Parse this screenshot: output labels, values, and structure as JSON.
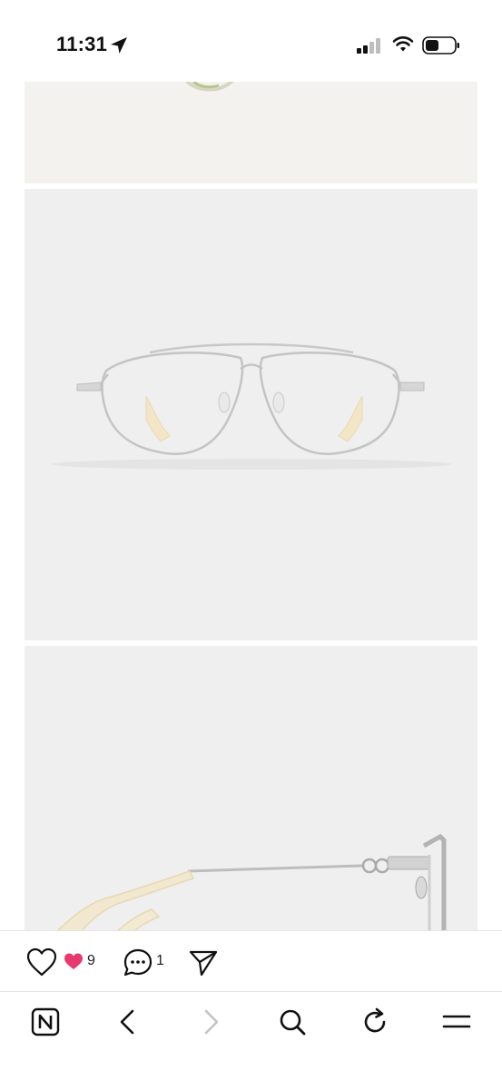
{
  "status_bar": {
    "time": "11:31",
    "icons": [
      "location-arrow-icon",
      "cellular-signal-icon",
      "wifi-icon",
      "battery-icon"
    ]
  },
  "feed": {
    "images": [
      {
        "subject": "glasses-temple-tip-partial"
      },
      {
        "subject": "silver-aviator-eyeglasses-front"
      },
      {
        "subject": "eyeglasses-temple-side-view"
      }
    ]
  },
  "actions": {
    "like_icon": "heart-outline-icon",
    "likes_icon": "heart-filled-icon",
    "like_count": "9",
    "comment_icon": "comment-bubble-icon",
    "comment_count": "1",
    "share_icon": "paper-plane-icon",
    "accent_color": "#e8386d"
  },
  "browser_nav": {
    "items": [
      "naver-home-icon",
      "back-arrow-icon",
      "forward-arrow-icon",
      "search-icon",
      "reload-icon",
      "menu-icon"
    ]
  }
}
